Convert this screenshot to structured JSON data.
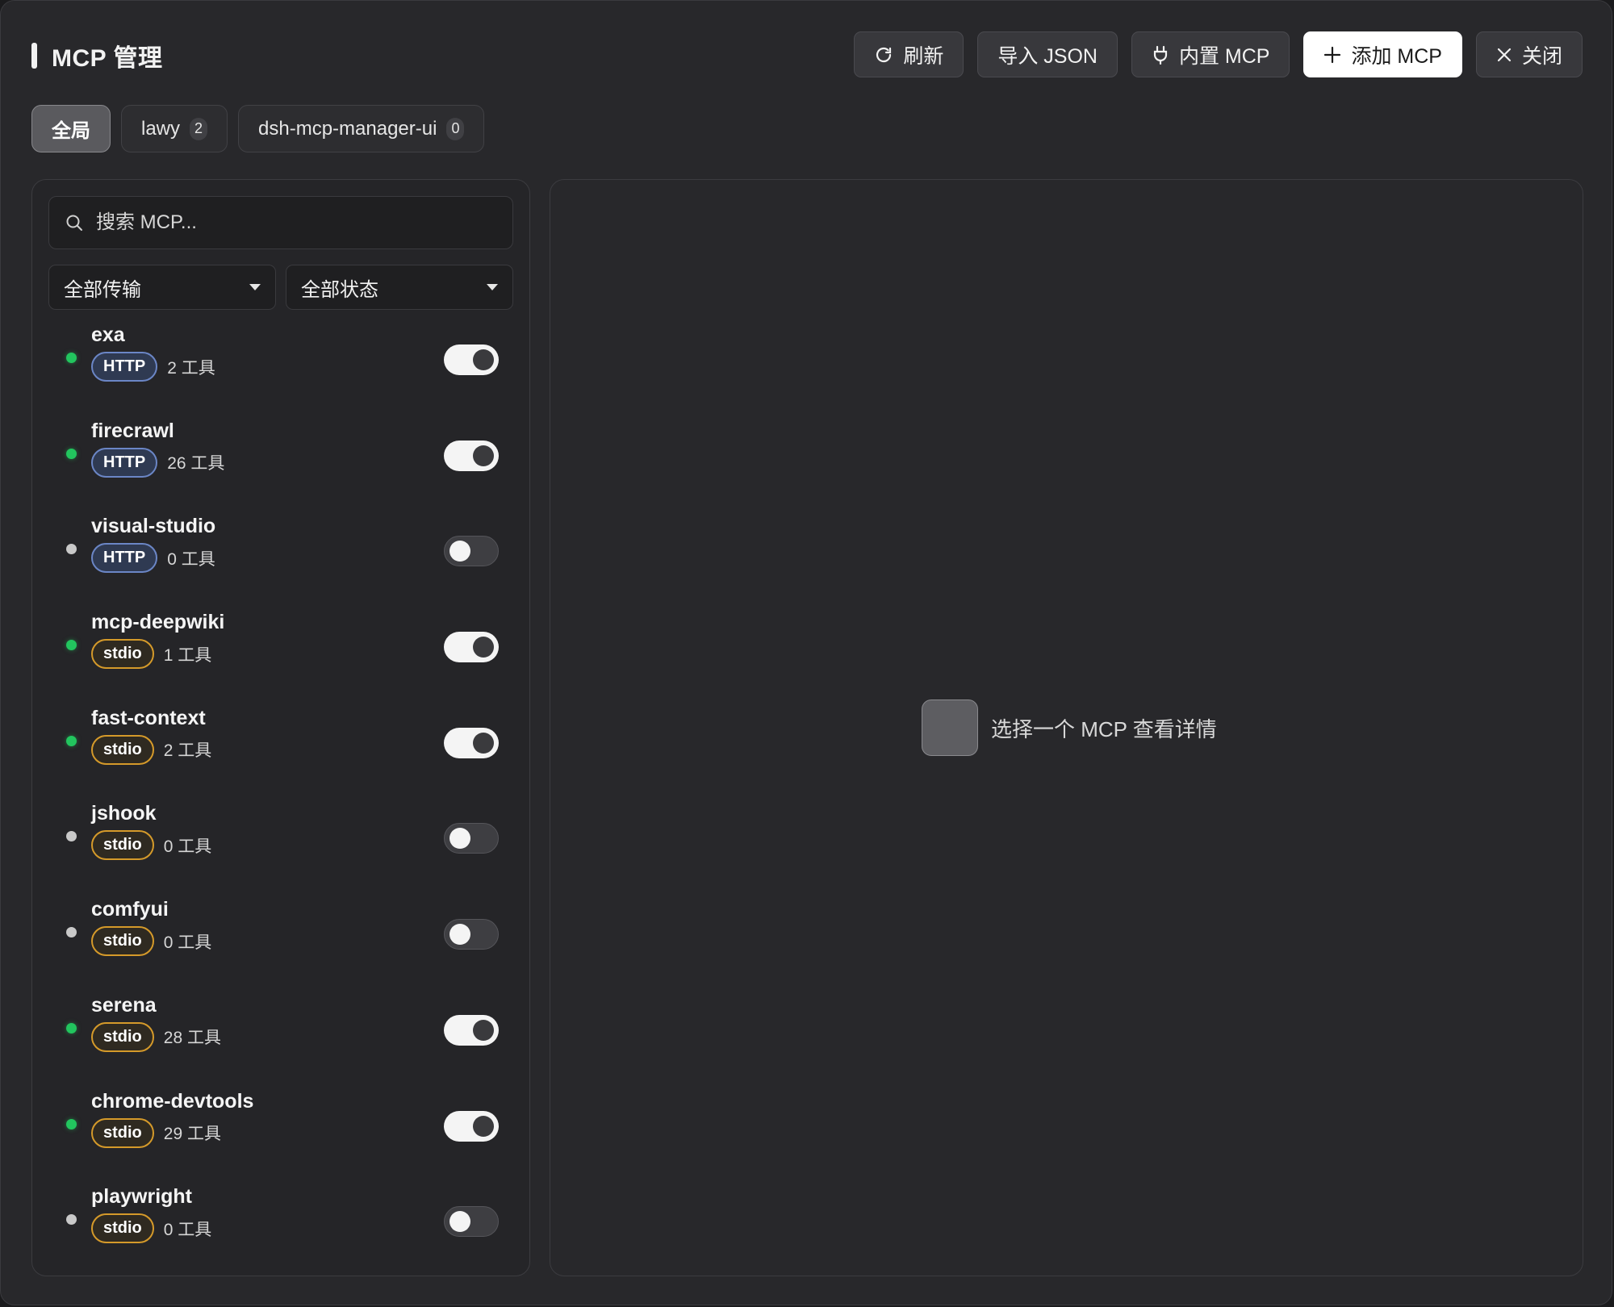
{
  "header": {
    "title": "MCP 管理",
    "buttons": {
      "refresh": "刷新",
      "import_json": "导入 JSON",
      "builtin": "内置 MCP",
      "add": "添加 MCP",
      "close": "关闭"
    }
  },
  "tabs": [
    {
      "label": "全局",
      "count": null,
      "active": true
    },
    {
      "label": "lawy",
      "count": "2"
    },
    {
      "label": "dsh-mcp-manager-ui",
      "count": "0"
    }
  ],
  "sidebar": {
    "search_placeholder": "搜索 MCP...",
    "filters": {
      "transport": "全部传输",
      "status": "全部状态"
    },
    "items": [
      {
        "name": "exa",
        "transport": "HTTP",
        "tools": "2 工具",
        "connected": true,
        "enabled": true
      },
      {
        "name": "firecrawl",
        "transport": "HTTP",
        "tools": "26 工具",
        "connected": true,
        "enabled": true
      },
      {
        "name": "visual-studio",
        "transport": "HTTP",
        "tools": "0 工具",
        "connected": false,
        "enabled": false
      },
      {
        "name": "mcp-deepwiki",
        "transport": "stdio",
        "tools": "1 工具",
        "connected": true,
        "enabled": true
      },
      {
        "name": "fast-context",
        "transport": "stdio",
        "tools": "2 工具",
        "connected": true,
        "enabled": true
      },
      {
        "name": "jshook",
        "transport": "stdio",
        "tools": "0 工具",
        "connected": false,
        "enabled": false
      },
      {
        "name": "comfyui",
        "transport": "stdio",
        "tools": "0 工具",
        "connected": false,
        "enabled": false
      },
      {
        "name": "serena",
        "transport": "stdio",
        "tools": "28 工具",
        "connected": true,
        "enabled": true
      },
      {
        "name": "chrome-devtools",
        "transport": "stdio",
        "tools": "29 工具",
        "connected": true,
        "enabled": true
      },
      {
        "name": "playwright",
        "transport": "stdio",
        "tools": "0 工具",
        "connected": false,
        "enabled": false
      }
    ]
  },
  "detail": {
    "empty_text": "选择一个 MCP 查看详情"
  },
  "colors": {
    "status_connected": "#22c55e",
    "status_disconnected": "#c9c9c9",
    "http_badge_border": "#6b86c6",
    "stdio_badge_border": "#d59a2a",
    "primary_button": "#ffffff"
  }
}
